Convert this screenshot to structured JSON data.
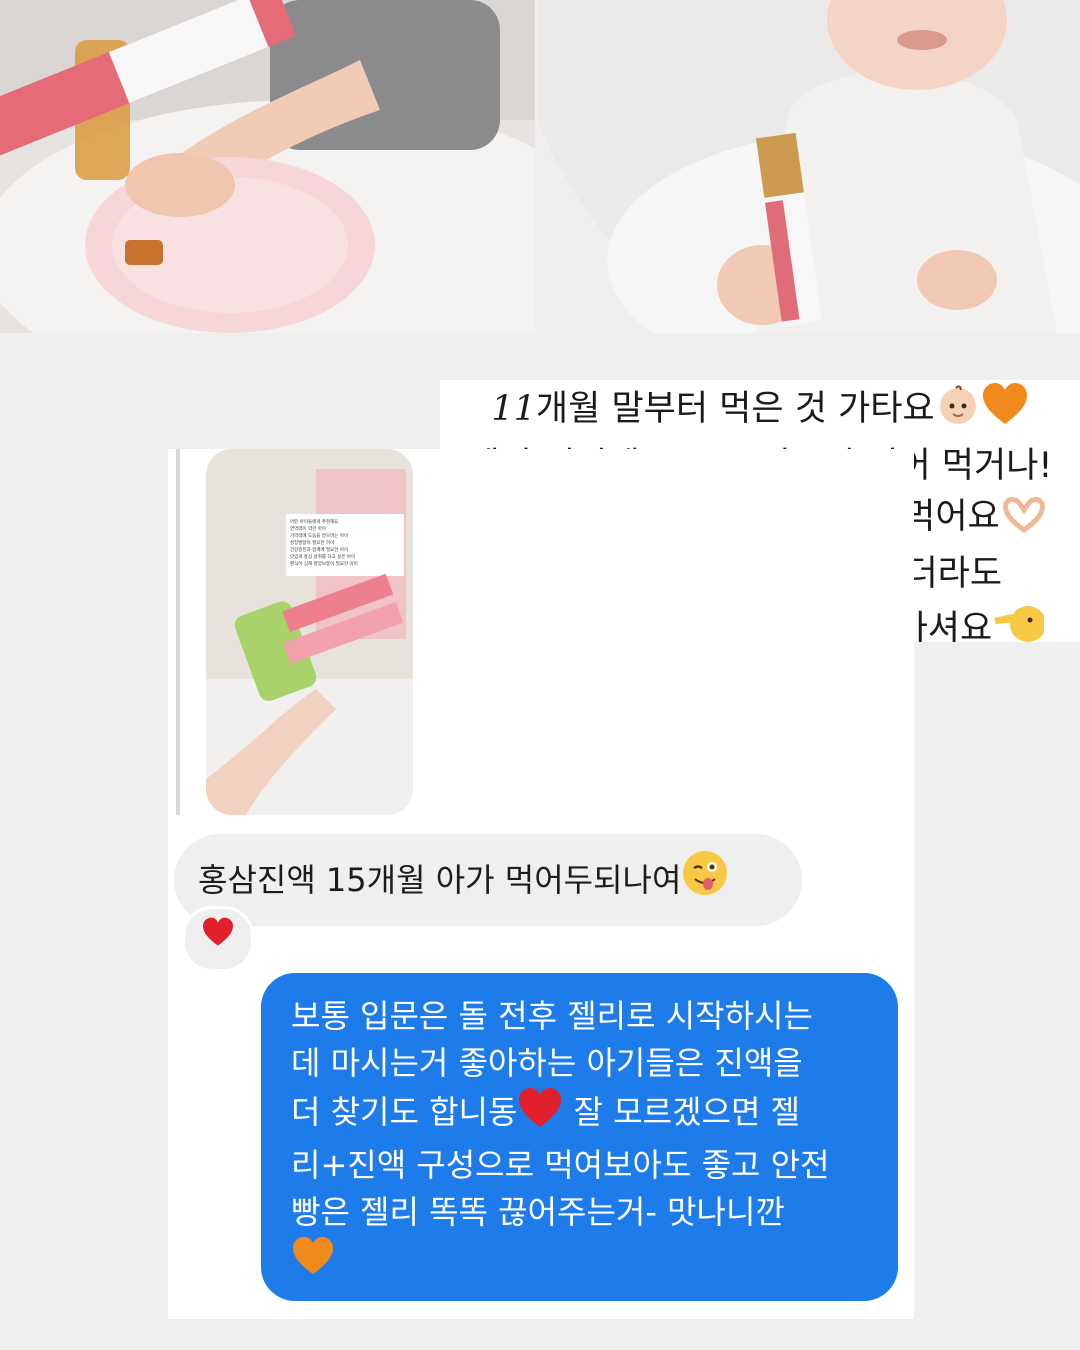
{
  "caption": {
    "line1_num": "11",
    "line1_text": "개월 말부터 먹은 것 가타요",
    "line1_emojis": [
      "baby-emoji",
      "orange-heart-emoji"
    ],
    "line2": "젤리 접시에 똑똑 끊어주면 집어 먹거나!",
    "line3": "조금씩 짜서 쥐어주시면 끊어 먹어요",
    "line3_emoji": "heart-hands-emoji",
    "line4": "응가에 혹시나 젤리가 나오더라도",
    "line5": "성분은 다 흡수되었으니 걱정마셔요",
    "line5_emoji": "pointing-face-emoji"
  },
  "chat": {
    "story_card_text": [
      "어떤 아이들에게 추천해요",
      "면역력이 약한 아이",
      "기억력에 도움을 받으려는 아이",
      "성장발달이 필요한 아이",
      "건강증진과 함께에 필요한 아이",
      "맛있게 홍삼 섭취를 하고 싶은 아이",
      "편식이 심해 영양보충이 필요한 아이"
    ],
    "incoming_message": "홍삼진액 15개월 아가 먹어두되나여",
    "incoming_emoji": "winking-tongue-emoji",
    "reaction_emoji": "red-heart-emoji",
    "outgoing_lines": [
      "보통 입문은 돌 전후 젤리로 시작하시는",
      "데 마시는거 좋아하는 아기들은 진액을",
      "더 찾기도 합니동",
      " 잘 모르겠으면 젤",
      "리+진액 구성으로 먹여보아도 좋고 안전",
      "빵은 젤리 똑똑 끊어주는거- 맛나니깐"
    ],
    "outgoing_emojis": [
      "red-heart-emoji",
      "orange-heart-emoji"
    ]
  },
  "colors": {
    "page_bg": "#efefef",
    "outgoing_bubble": "#1e7bea",
    "incoming_bubble": "#efefef",
    "caption_bg": "#ffffff"
  }
}
